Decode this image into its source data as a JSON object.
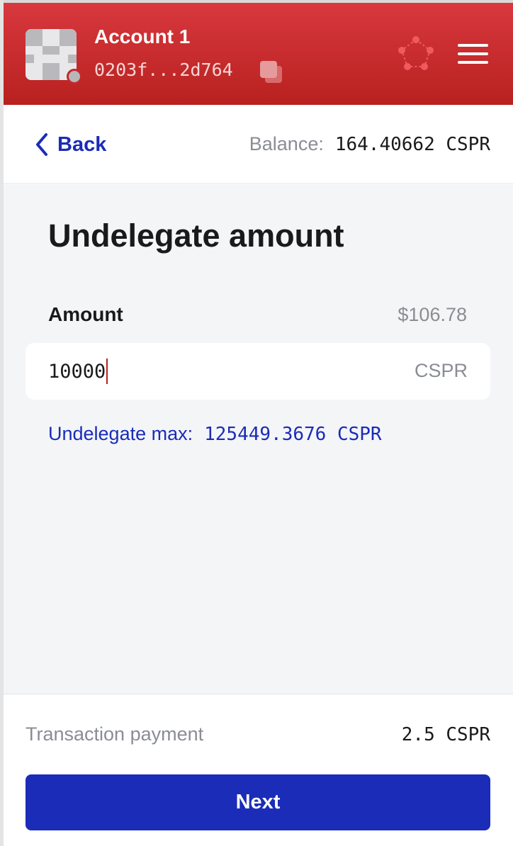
{
  "header": {
    "account_name": "Account 1",
    "account_hash": "0203f...2d764",
    "icons": {
      "avatar": "account-avatar",
      "copy": "copy-icon",
      "network": "network-icon",
      "menu": "hamburger-menu-icon"
    },
    "colors": {
      "header_red": "#c4282b"
    }
  },
  "nav": {
    "back_label": "Back",
    "balance_label": "Balance:",
    "balance_value": "164.40662 CSPR"
  },
  "main": {
    "title": "Undelegate amount",
    "amount_label": "Amount",
    "amount_fiat": "$106.78",
    "amount_value": "10000",
    "amount_unit": "CSPR",
    "max_label": "Undelegate max:",
    "max_value": "125449.3676 CSPR"
  },
  "footer": {
    "fee_label": "Transaction payment",
    "fee_value": "2.5 CSPR",
    "next_label": "Next"
  },
  "colors": {
    "accent": "#1a2cb8",
    "background": "#f4f5f7"
  }
}
